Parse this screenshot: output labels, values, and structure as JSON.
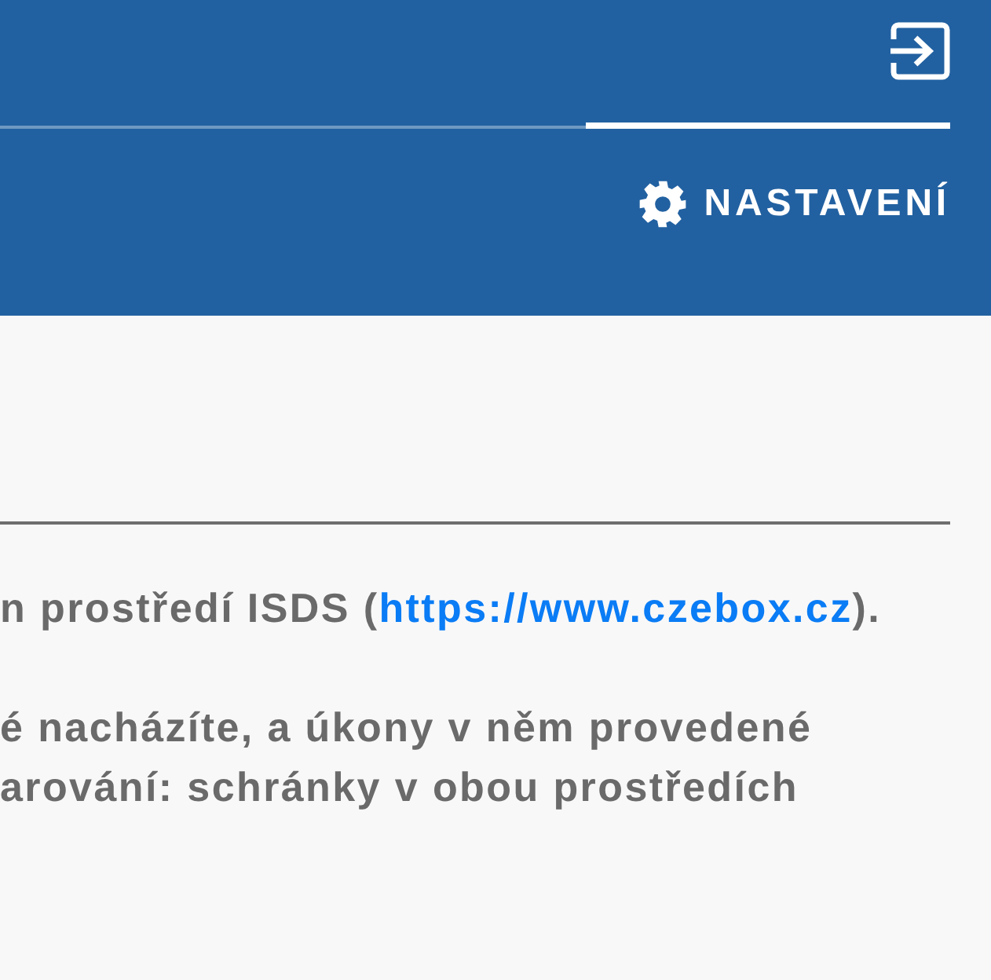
{
  "header": {
    "tabs": [
      {
        "selected": false
      },
      {
        "selected": true
      }
    ],
    "settings_button": {
      "label": "NASTAVENÍ"
    }
  },
  "content": {
    "paragraphs": [
      {
        "before": "n prostředí ISDS (",
        "link": "https://www.czebox.cz",
        "after": ")."
      },
      {
        "lines": [
          "é nacházíte, a úkony v něm provedené",
          "arování: schránky v obou prostředích"
        ]
      }
    ]
  }
}
